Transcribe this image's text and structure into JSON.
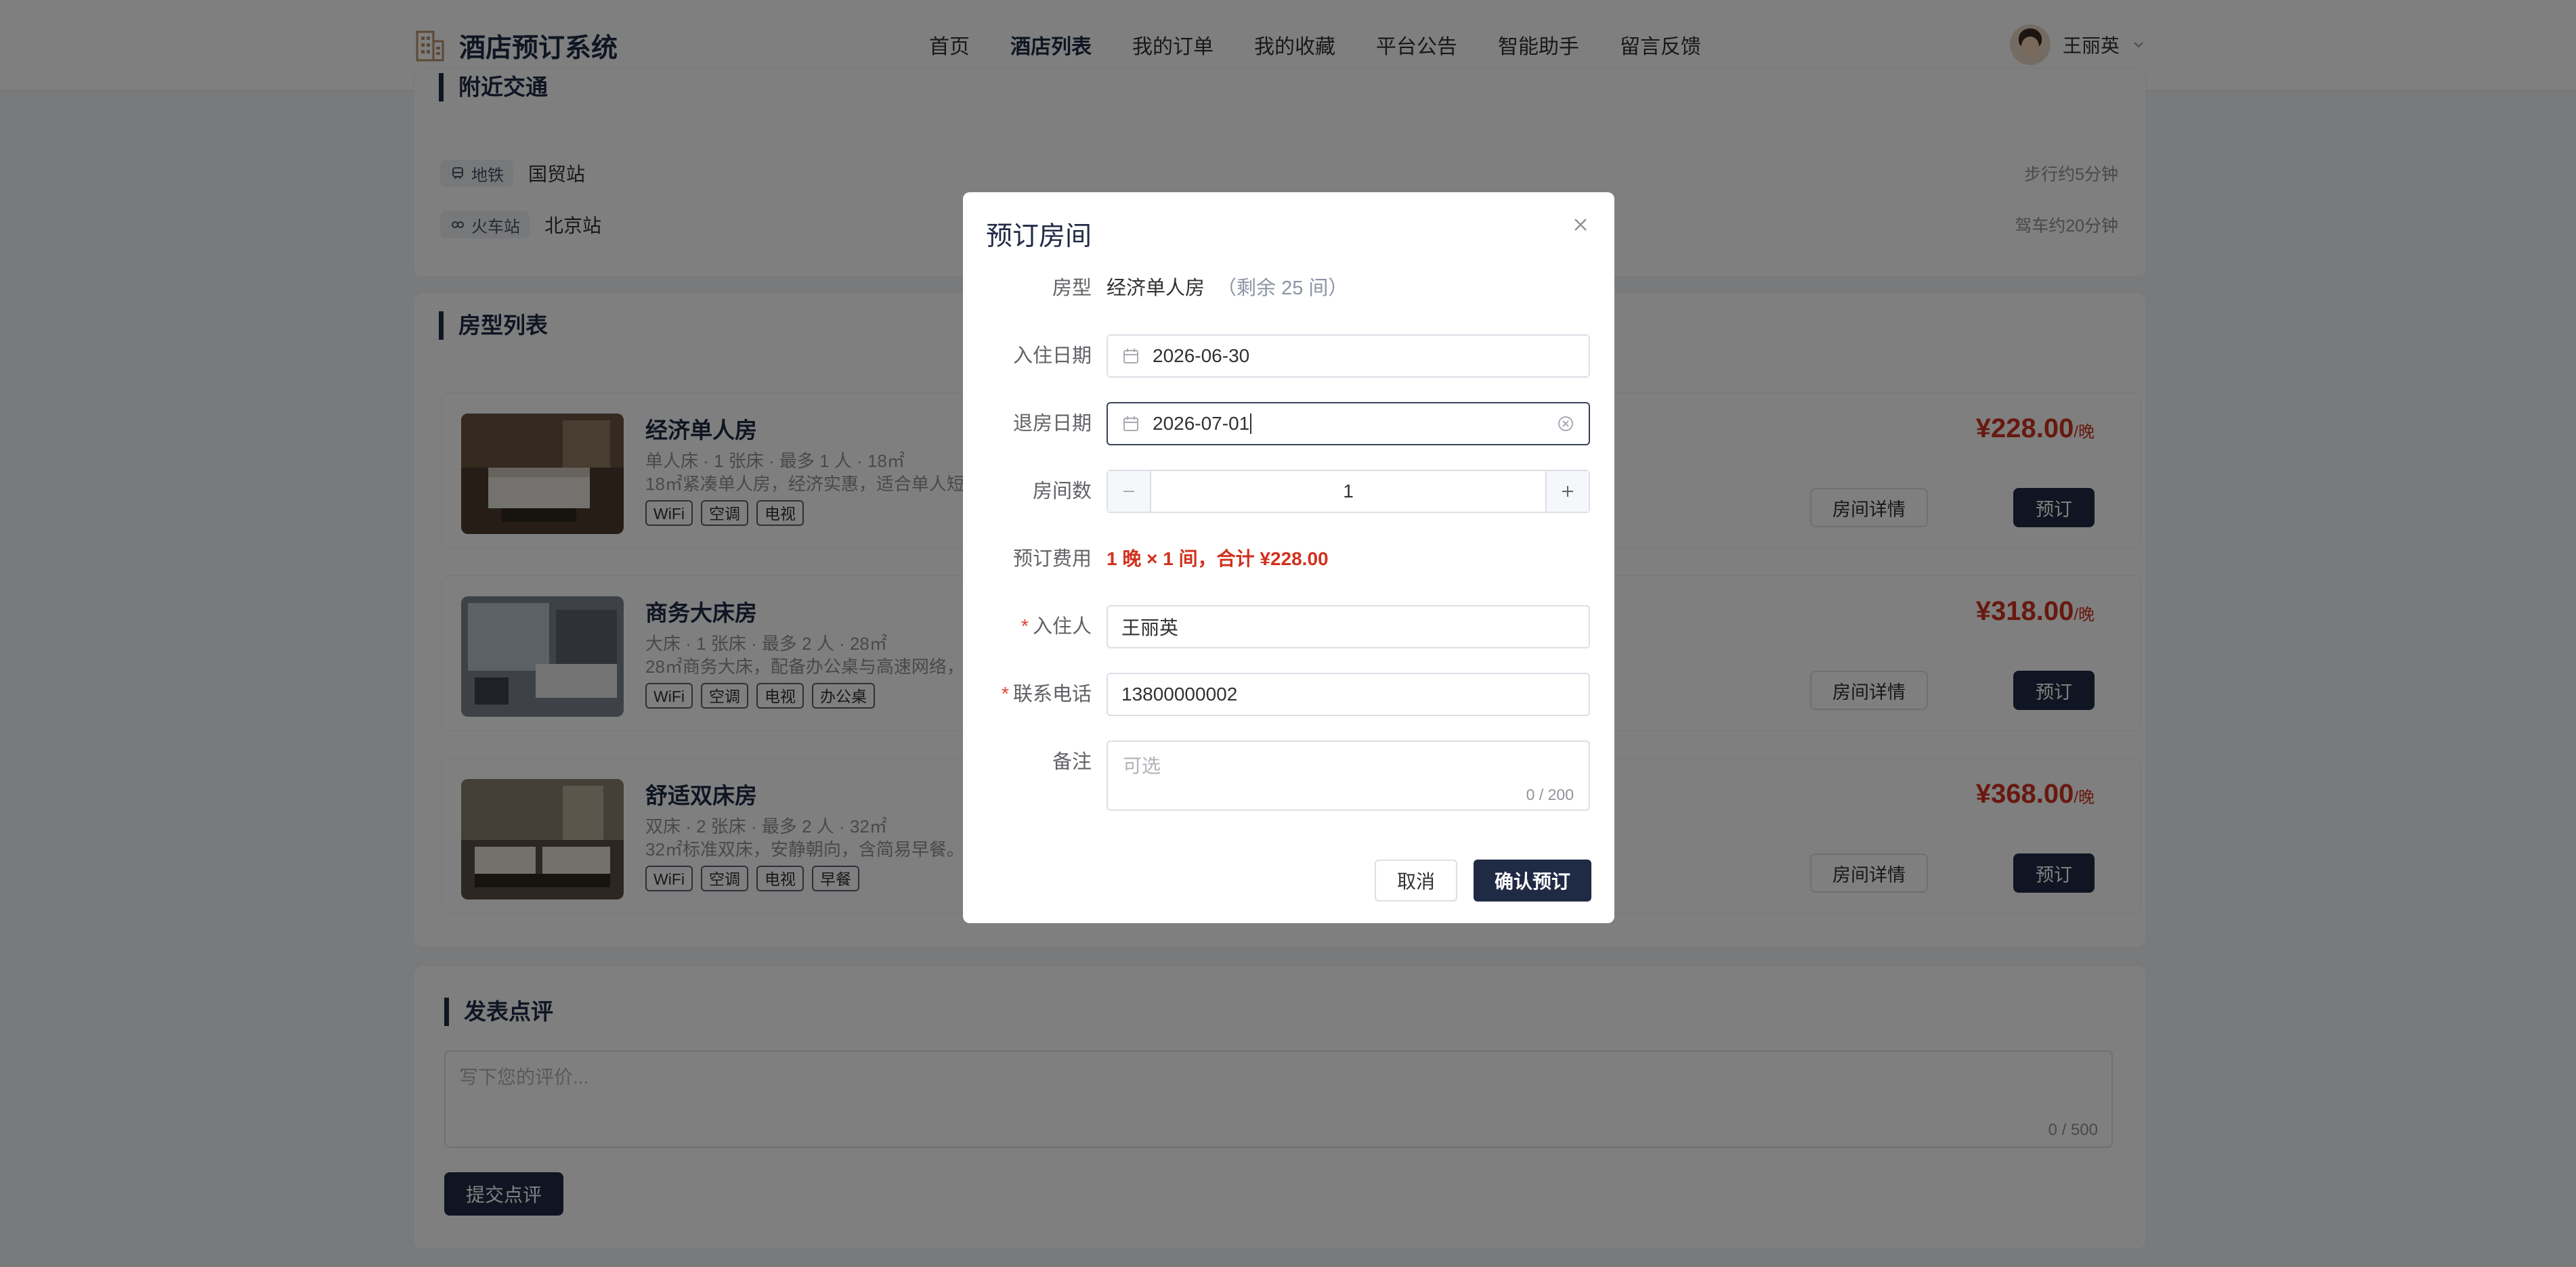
{
  "header": {
    "logo": "酒店预订系统",
    "nav": [
      "首页",
      "酒店列表",
      "我的订单",
      "我的收藏",
      "平台公告",
      "智能助手",
      "留言反馈"
    ],
    "active_nav": "酒店列表",
    "user_name": "王丽英"
  },
  "traffic": {
    "title": "附近交通",
    "items": [
      {
        "tag": "地铁",
        "name": "国贸站",
        "distance": "步行约5分钟"
      },
      {
        "tag": "火车站",
        "name": "北京站",
        "distance": "驾车约20分钟"
      }
    ]
  },
  "rooms": {
    "title": "房型列表",
    "detail_label": "房间详情",
    "book_label": "预订",
    "items": [
      {
        "name": "经济单人房",
        "meta": "单人床 · 1 张床 · 最多 1 人 · 18㎡",
        "desc": "18㎡紧凑单人房，经济实惠，适合单人短",
        "tags": [
          "WiFi",
          "空调",
          "电视"
        ],
        "price": "¥228.00",
        "unit": "/晚"
      },
      {
        "name": "商务大床房",
        "meta": "大床 · 1 张床 · 最多 2 人 · 28㎡",
        "desc": "28㎡商务大床，配备办公桌与高速网络，",
        "tags": [
          "WiFi",
          "空调",
          "电视",
          "办公桌"
        ],
        "price": "¥318.00",
        "unit": "/晚"
      },
      {
        "name": "舒适双床房",
        "meta": "双床 · 2 张床 · 最多 2 人 · 32㎡",
        "desc": "32㎡标准双床，安静朝向，含简易早餐。",
        "tags": [
          "WiFi",
          "空调",
          "电视",
          "早餐"
        ],
        "price": "¥368.00",
        "unit": "/晚"
      }
    ]
  },
  "review": {
    "title": "发表点评",
    "placeholder": "写下您的评价...",
    "count": "0 / 500",
    "submit": "提交点评"
  },
  "modal": {
    "title": "预订房间",
    "room_type_label": "房型",
    "room_type": "经济单人房",
    "remaining": "（剩余 25 间）",
    "checkin_label": "入住日期",
    "checkin": "2026-06-30",
    "checkout_label": "退房日期",
    "checkout": "2026-07-01",
    "rooms_label": "房间数",
    "rooms_value": "1",
    "cost_label": "预订费用",
    "cost": "1 晚 × 1 间，合计 ¥228.00",
    "guest_label": "入住人",
    "guest": "王丽英",
    "phone_label": "联系电话",
    "phone": "13800000002",
    "note_label": "备注",
    "note_placeholder": "可选",
    "note_count": "0 / 200",
    "cancel": "取消",
    "confirm": "确认预订"
  },
  "colors": {
    "primary": "#1f2a44",
    "price": "#d0321e",
    "required": "#e0463a"
  }
}
